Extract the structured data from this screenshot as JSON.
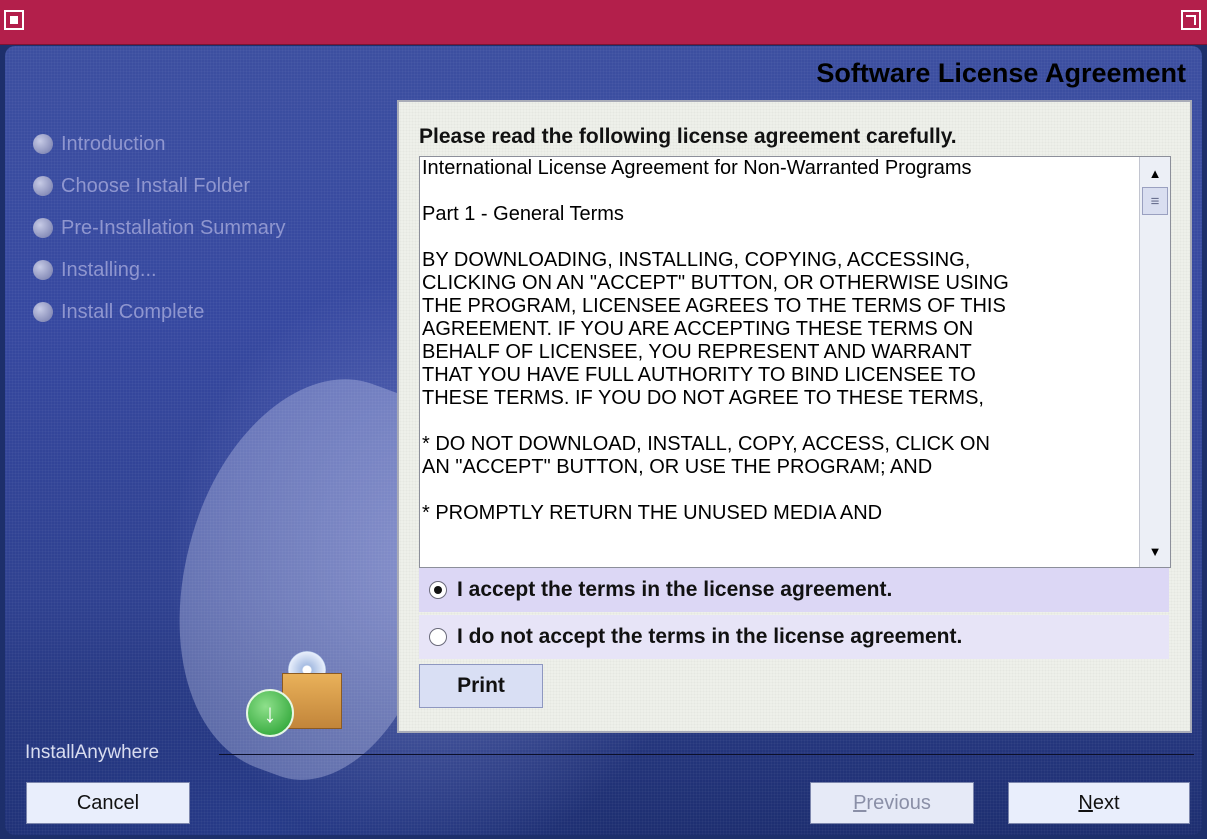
{
  "window": {
    "header_title": "Software License Agreement"
  },
  "steps": [
    {
      "label": "Introduction"
    },
    {
      "label": "Choose Install Folder"
    },
    {
      "label": "Pre-Installation Summary"
    },
    {
      "label": "Installing..."
    },
    {
      "label": "Install Complete"
    }
  ],
  "panel": {
    "heading": "Please read the following license agreement carefully.",
    "license_text": "International License Agreement for Non-Warranted Programs\n\nPart 1 - General Terms\n\nBY DOWNLOADING, INSTALLING, COPYING, ACCESSING,\nCLICKING ON AN \"ACCEPT\" BUTTON, OR OTHERWISE USING\nTHE PROGRAM, LICENSEE AGREES TO THE TERMS OF THIS\nAGREEMENT. IF YOU ARE ACCEPTING THESE TERMS ON\nBEHALF OF LICENSEE, YOU REPRESENT AND WARRANT\nTHAT YOU HAVE FULL AUTHORITY TO BIND LICENSEE TO\nTHESE TERMS. IF YOU DO NOT AGREE TO THESE TERMS,\n\n* DO NOT DOWNLOAD, INSTALL, COPY, ACCESS, CLICK ON\nAN \"ACCEPT\" BUTTON, OR USE THE PROGRAM; AND\n\n* PROMPTLY RETURN THE UNUSED MEDIA AND",
    "accept_label": "I accept the terms in the license agreement.",
    "decline_label": "I do not accept the terms in the license agreement.",
    "accept_selected": true,
    "print_label": "Print"
  },
  "footer": {
    "brand": "InstallAnywhere",
    "cancel_label": "Cancel",
    "previous_label": "Previous",
    "next_label": "Next"
  },
  "colors": {
    "titlebar": "#b31f4b",
    "panel_bg": "#eef0ea",
    "radio_row": "#dcd7f5"
  },
  "icons": [
    "window-menu-icon",
    "maximize-icon",
    "step-bullet-icon",
    "scroll-up-icon",
    "scroll-down-icon",
    "install-box-icon",
    "download-arrow-icon"
  ]
}
